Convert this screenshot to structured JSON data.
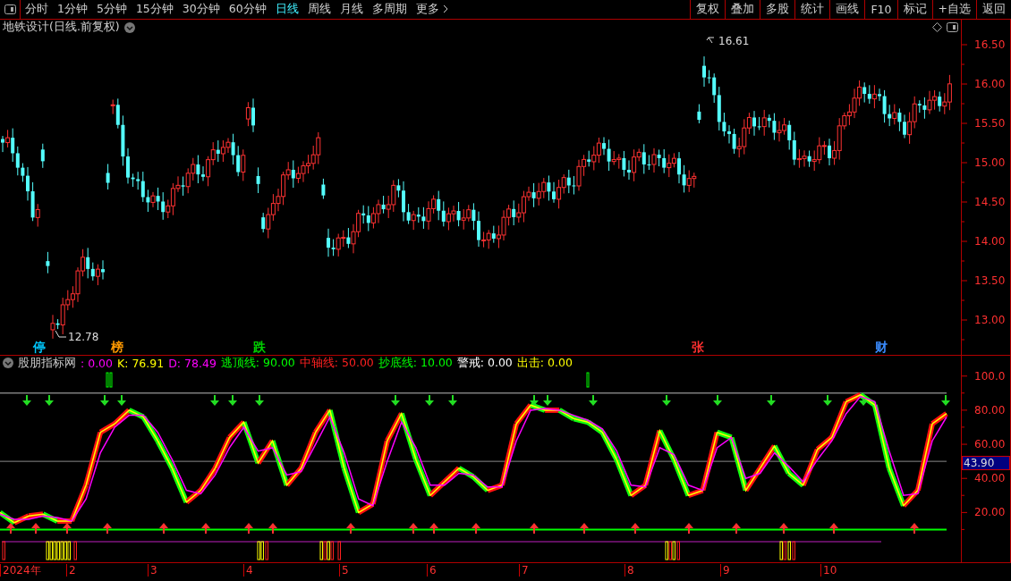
{
  "toolbar": {
    "tabs": [
      {
        "label": "分时",
        "selected": false
      },
      {
        "label": "1分钟",
        "selected": false
      },
      {
        "label": "5分钟",
        "selected": false
      },
      {
        "label": "15分钟",
        "selected": false
      },
      {
        "label": "30分钟",
        "selected": false
      },
      {
        "label": "60分钟",
        "selected": false
      },
      {
        "label": "日线",
        "selected": true
      },
      {
        "label": "周线",
        "selected": false
      },
      {
        "label": "月线",
        "selected": false
      },
      {
        "label": "多周期",
        "selected": false
      },
      {
        "label": "更多",
        "selected": false
      }
    ],
    "buttons": [
      "复权",
      "叠加",
      "多股",
      "统计",
      "画线",
      "F10",
      "标记",
      "+自选",
      "返回"
    ]
  },
  "price_panel": {
    "title": "地铁设计(日线.前复权)",
    "high_marker": "16.61",
    "low_marker": "12.78",
    "events": [
      {
        "label": "停",
        "color": "#00c8ff"
      },
      {
        "label": "榜",
        "color": "#ff9900"
      },
      {
        "label": "跌",
        "color": "#00d000"
      },
      {
        "label": "张",
        "color": "#ff3030"
      },
      {
        "label": "财",
        "color": "#3a8cff"
      }
    ],
    "axis_ticks": [
      "16.50",
      "16.00",
      "15.50",
      "15.00",
      "14.50",
      "14.00",
      "13.50",
      "13.00"
    ]
  },
  "indicator_panel": {
    "legend": [
      {
        "text": "股朋指标网",
        "color": "#c8c8c8"
      },
      {
        "text": ": 0.00",
        "color": "#ff00ff"
      },
      {
        "text": ": 76.91",
        "color": "#ffff00",
        "kind": "series"
      },
      {
        "text": ": 78.49",
        "color": "#ff00ff",
        "kind": "series"
      },
      {
        "text": "逃顶线: 90.00",
        "color": "#00ff00"
      },
      {
        "text": "中轴线: 50.00",
        "color": "#ff2020"
      },
      {
        "text": "抄底线: 10.00",
        "color": "#00ff00"
      },
      {
        "text": "警戒: 0.00",
        "color": "#ffffff"
      },
      {
        "text": "出击: 0.00",
        "color": "#ffff00"
      }
    ],
    "cursor_value": "43.90",
    "chart_data": {
      "type": "line",
      "categories": [
        null,
        null,
        null,
        null,
        null,
        null,
        null,
        null,
        null,
        null,
        null,
        null,
        null,
        null,
        null,
        null,
        null,
        null,
        null,
        null,
        null,
        null,
        null,
        null,
        null,
        null,
        null,
        null,
        null,
        null,
        null,
        null,
        null,
        null,
        null,
        null,
        null,
        null,
        null,
        null,
        null,
        null,
        null,
        null,
        null,
        null,
        null,
        null,
        null,
        null,
        null,
        null,
        null,
        null,
        null,
        null,
        null,
        null,
        null,
        null,
        null,
        null,
        null,
        null,
        null,
        null,
        null
      ],
      "ylim": [
        5,
        103
      ],
      "yticks": [
        {
          "value": 100,
          "label": "100.0"
        },
        {
          "value": 80,
          "label": "80.00"
        },
        {
          "value": 60,
          "label": "60.00"
        },
        {
          "value": 40,
          "label": "40.00"
        },
        {
          "value": 20,
          "label": "20.00"
        }
      ],
      "series": [
        {
          "name": "K",
          "color": "#ffff00",
          "values": [
            20,
            14,
            18,
            19,
            15,
            15,
            36,
            67,
            72,
            80,
            76,
            62,
            46,
            26,
            33,
            46,
            64,
            73,
            49,
            62,
            36,
            46,
            67,
            80,
            46,
            20,
            25,
            62,
            78,
            51,
            30,
            38,
            46,
            41,
            33,
            36,
            72,
            83,
            80,
            80,
            75,
            73,
            67,
            51,
            30,
            36,
            68,
            51,
            30,
            33,
            67,
            64,
            33,
            46,
            59,
            43,
            36,
            57,
            64,
            85,
            89,
            83,
            46,
            24,
            33,
            72,
            78
          ]
        },
        {
          "name": "D",
          "color": "#ff00ff",
          "values": [
            19,
            16,
            16,
            18,
            17,
            15,
            28,
            55,
            70,
            77,
            77,
            67,
            51,
            33,
            31,
            42,
            58,
            70,
            56,
            58,
            42,
            44,
            60,
            76,
            55,
            28,
            24,
            50,
            73,
            58,
            36,
            36,
            43,
            42,
            35,
            35,
            62,
            80,
            81,
            80,
            77,
            74,
            69,
            56,
            36,
            35,
            58,
            54,
            36,
            33,
            58,
            64,
            40,
            43,
            55,
            47,
            38,
            51,
            62,
            78,
            88,
            85,
            56,
            30,
            31,
            62,
            76
          ]
        }
      ]
    }
  },
  "date_axis": [
    "2024年",
    "2",
    "3",
    "4",
    "5",
    "6",
    "7",
    "8",
    "9",
    "10"
  ]
}
